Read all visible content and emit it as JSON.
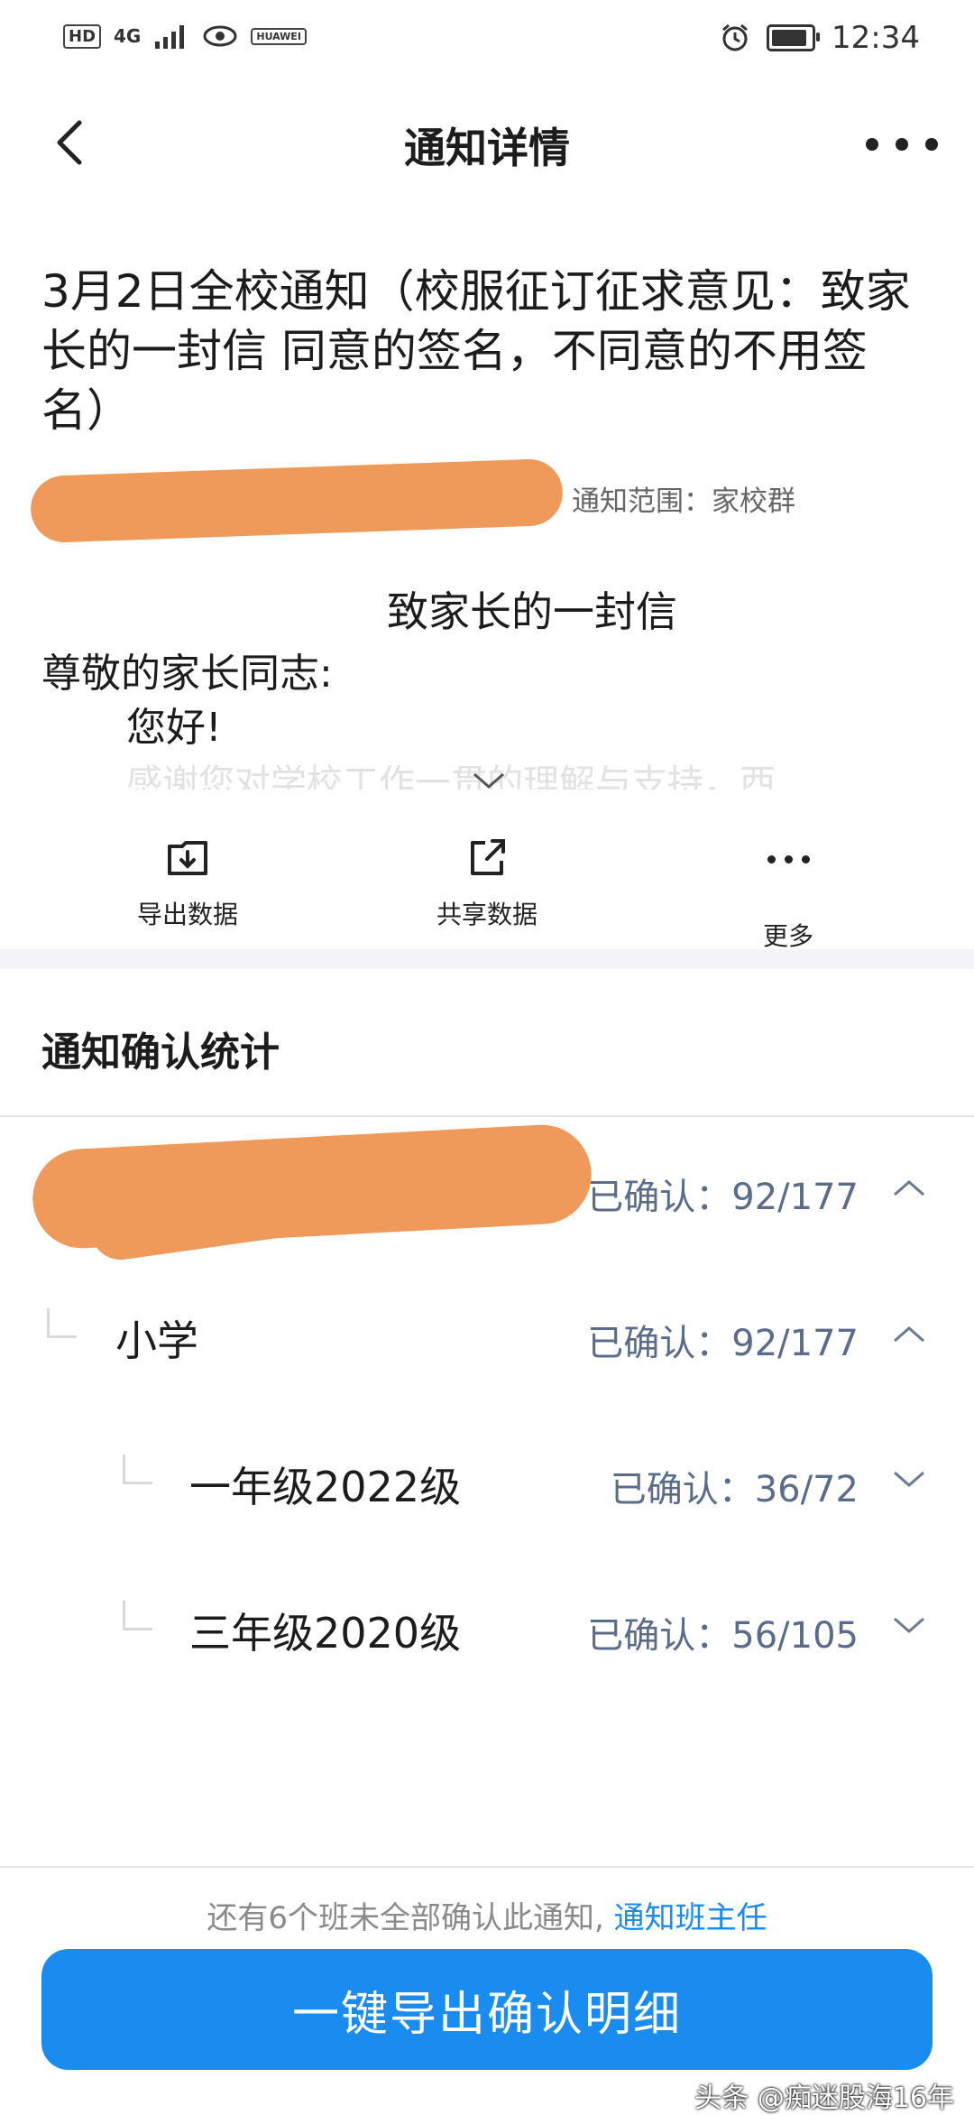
{
  "status_bar": {
    "left_badges": [
      "HD",
      "4G",
      "HUAWEI"
    ],
    "time": "12:34",
    "battery_level": 0.8
  },
  "nav": {
    "title": "通知详情"
  },
  "notice": {
    "title": "3月2日全校通知（校服征订征求意见：致家长的一封信 同意的签名，不同意的不用签名）",
    "scope": "通知范围：家校群",
    "letter_heading": "致家长的一封信",
    "salutation": "尊敬的家长同志:",
    "greeting": "您好!",
    "faded_line": "感谢您对学校工作一贯的理解与支持，西"
  },
  "actions": [
    {
      "label": "导出数据",
      "icon": "export-icon"
    },
    {
      "label": "共享数据",
      "icon": "share-icon"
    },
    {
      "label": "更多",
      "icon": "more-icon"
    }
  ],
  "stats": {
    "title": "通知确认统计",
    "rows": [
      {
        "label": "",
        "count": "已确认：92/177",
        "expanded": true
      },
      {
        "label": "小学",
        "count": "已确认：92/177",
        "expanded": true
      },
      {
        "label": "一年级2022级",
        "count": "已确认：36/72",
        "expanded": false
      },
      {
        "label": "三年级2020级",
        "count": "已确认：56/105",
        "expanded": false
      }
    ]
  },
  "footer": {
    "hint": "还有6个班未全部确认此通知,",
    "hint_link": "通知班主任",
    "cta": "一键导出确认明细"
  },
  "watermark": "头条 @痴迷股海16年",
  "colors": {
    "accent": "#1a8cf0",
    "count_text": "#5b6c8a",
    "redaction": "#ef9a5a"
  }
}
